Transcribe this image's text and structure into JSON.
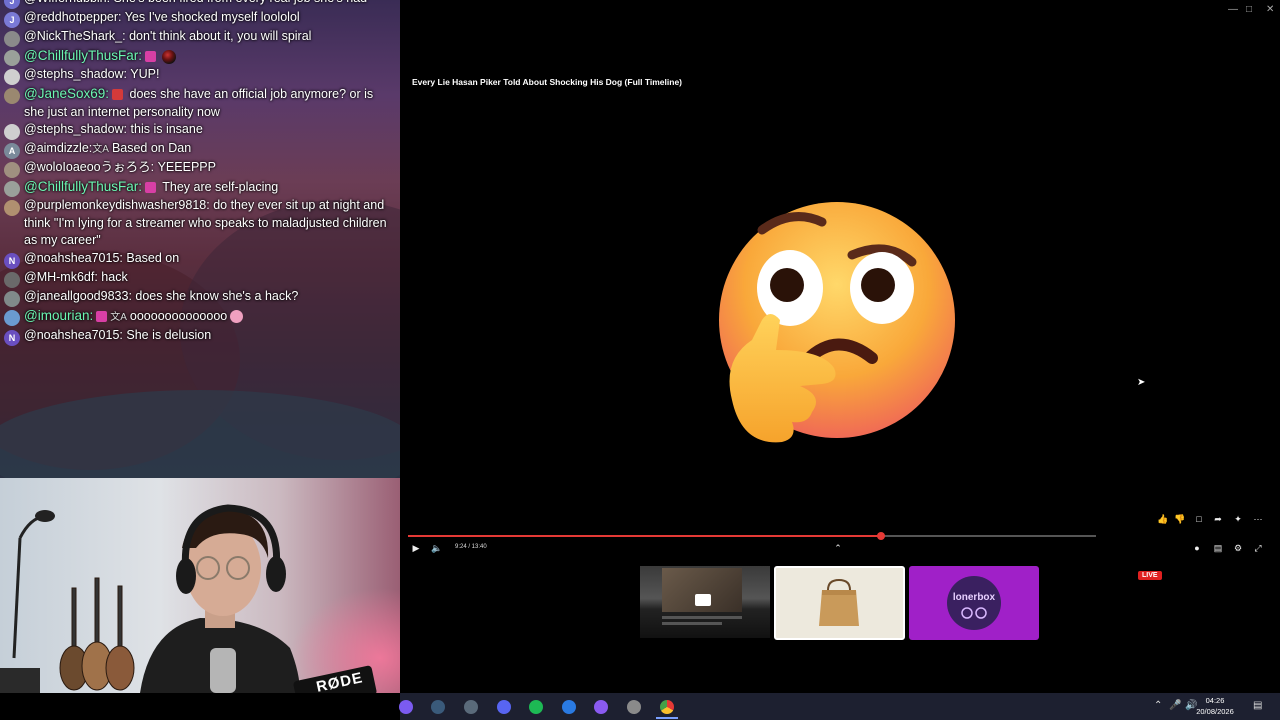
{
  "chat": {
    "messages": [
      {
        "badge": "J",
        "badge_color": "#6f6fd0",
        "user": "@Wiffernubbin:",
        "text": "She's been fired from every real job she's had"
      },
      {
        "badge": "J",
        "badge_color": "#7a7ad6",
        "user": "@reddhotpepper:",
        "text": "Yes I've shocked myself loololol"
      },
      {
        "badge": "",
        "badge_color": "#8a8a8a",
        "user": "@NickTheShark_:",
        "text": "don't think about it, you will spiral"
      },
      {
        "badge": "",
        "badge_color": "#9aa09a",
        "user": "@ChillfullyThusFar:",
        "text": "",
        "green": true,
        "emotes": [
          "pink",
          "ball"
        ]
      },
      {
        "badge": "",
        "badge_color": "#cfcfcf",
        "user": "@stephs_shadow:",
        "text": "YUP!"
      },
      {
        "badge": "",
        "badge_color": "#9a8870",
        "user": "@JaneSox69:",
        "text": "does she have an official job anymore? or is she just an internet personality now",
        "green": true,
        "emotes": [
          "red"
        ]
      },
      {
        "badge": "",
        "badge_color": "#cfcfcf",
        "user": "@stephs_shadow:",
        "text": "this is insane"
      },
      {
        "badge": "A",
        "badge_color": "#7a8a9a",
        "user": "@aimdizzle:",
        "text": "Based on Dan",
        "translated": true
      },
      {
        "badge": "",
        "badge_color": "#a09080",
        "user": "@woloIoaeooうぉろろ:",
        "text": "YEEEPPP"
      },
      {
        "badge": "",
        "badge_color": "#9aa09a",
        "user": "@ChillfullyThusFar:",
        "text": "They are self-placing",
        "green": true,
        "emotes": [
          "pink"
        ]
      },
      {
        "badge": "",
        "badge_color": "#b09070",
        "user": "@purplemonkeydishwasher9818:",
        "text": "do they ever sit up at night and think \"I'm lying for a streamer who speaks to maladjusted children as my career\""
      },
      {
        "badge": "N",
        "badge_color": "#6a4fc0",
        "user": "@noahshea7015:",
        "text": "Based on"
      },
      {
        "badge": "",
        "badge_color": "#6a6a6a",
        "user": "@MH-mk6df:",
        "text": "hack"
      },
      {
        "badge": "",
        "badge_color": "#808a8a",
        "user": "@janeallgood9833:",
        "text": "does she know she's a hack?"
      },
      {
        "badge": "",
        "badge_color": "#6a9ad0",
        "user": "@imourian:",
        "text": "oooooooooooooo",
        "green": true,
        "emotes": [
          "pink"
        ],
        "translated": true,
        "trailing_emote": true
      },
      {
        "badge": "N",
        "badge_color": "#6a4fc0",
        "user": "@noahshea7015:",
        "text": "She is delusion"
      }
    ]
  },
  "webcam": {
    "mic_brand": "RØDE"
  },
  "video": {
    "title": "Every Lie Hasan Piker Told About Shocking His Dog (Full Timeline)",
    "time": "9:24 / 13:40",
    "progress": 0.688,
    "emoji": "thinking-face",
    "live_label": "LIVE",
    "loner_label": "lonerbox"
  },
  "taskbar": {
    "time": "04:26",
    "date": "20/08/2026"
  },
  "colors": {
    "accent_red": "#e53935",
    "chat_green": "#6cf7b3",
    "loner_purple": "#a020c8"
  }
}
